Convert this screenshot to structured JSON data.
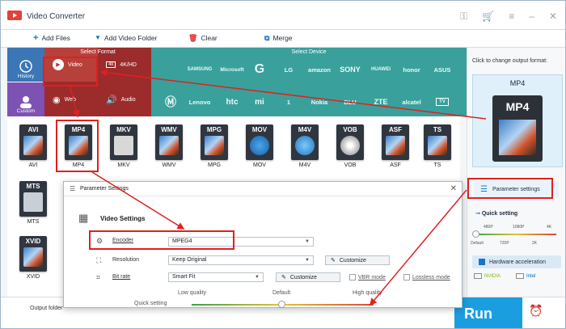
{
  "app": {
    "title": "Video Converter"
  },
  "toolbar": {
    "add_files": "Add Files",
    "add_video_folder": "Add Video Folder",
    "clear": "Clear",
    "merge": "Merge"
  },
  "format_panel": {
    "select_format_label": "Select Format",
    "select_device_label": "Select Device",
    "history": "History",
    "custom": "Custom",
    "video": "Video",
    "fourk": "4K/HD",
    "web": "Web",
    "audio": "Audio"
  },
  "brands": [
    "SAMSUNG",
    "Microsoft",
    "G",
    "LG",
    "amazon",
    "SONY",
    "HUAWEI",
    "honor",
    "ASUS",
    "Lenovo",
    "htc",
    "mi",
    "1",
    "Nokia",
    "BLU",
    "ZTE",
    "alcatel",
    "TV"
  ],
  "formats": [
    {
      "tag": "AVI",
      "name": "AVI"
    },
    {
      "tag": "MP4",
      "name": "MP4"
    },
    {
      "tag": "MKV",
      "name": "MKV"
    },
    {
      "tag": "WMV",
      "name": "WMV"
    },
    {
      "tag": "MPG",
      "name": "MPG"
    },
    {
      "tag": "MOV",
      "name": "MOV"
    },
    {
      "tag": "M4V",
      "name": "M4V"
    },
    {
      "tag": "VOB",
      "name": "VOB"
    },
    {
      "tag": "ASF",
      "name": "ASF"
    },
    {
      "tag": "TS",
      "name": "TS"
    },
    {
      "tag": "MTS",
      "name": "MTS"
    },
    {
      "tag": "XVID",
      "name": "XVID"
    }
  ],
  "right_panel": {
    "click_to_change": "Click to change output format:",
    "output_format": "MP4",
    "parameter_settings": "Parameter settings",
    "quick_setting": "Quick setting",
    "ticks_top": [
      "480P",
      "1080P",
      "4K"
    ],
    "ticks_bottom": [
      "Default",
      "720P",
      "2K"
    ],
    "hardware_acceleration": "Hardware acceleration",
    "gpu_nvidia": "NVIDIA",
    "gpu_intel": "Intel"
  },
  "dialog": {
    "title": "Parameter Settings",
    "video_settings": "Video Settings",
    "encoder_label": "Encoder",
    "encoder_value": "MPEG4",
    "resolution_label": "Resolution",
    "resolution_value": "Keep Original",
    "customize": "Customize",
    "bitrate_label": "Bit rate",
    "bitrate_value": "Smart Fit",
    "vbr_mode": "VBR mode",
    "lossless_mode": "Lossless mode",
    "low_quality": "Low quality",
    "default": "Default",
    "high_quality": "High quality",
    "quick_setting": "Quick setting"
  },
  "bottom": {
    "output_folder": "Output folder",
    "run": "Run"
  },
  "colors": {
    "format_red": "#9c2b2b",
    "device_teal": "#3aa09b",
    "run_blue": "#1a9ee0",
    "annotation_red": "#e02020"
  }
}
